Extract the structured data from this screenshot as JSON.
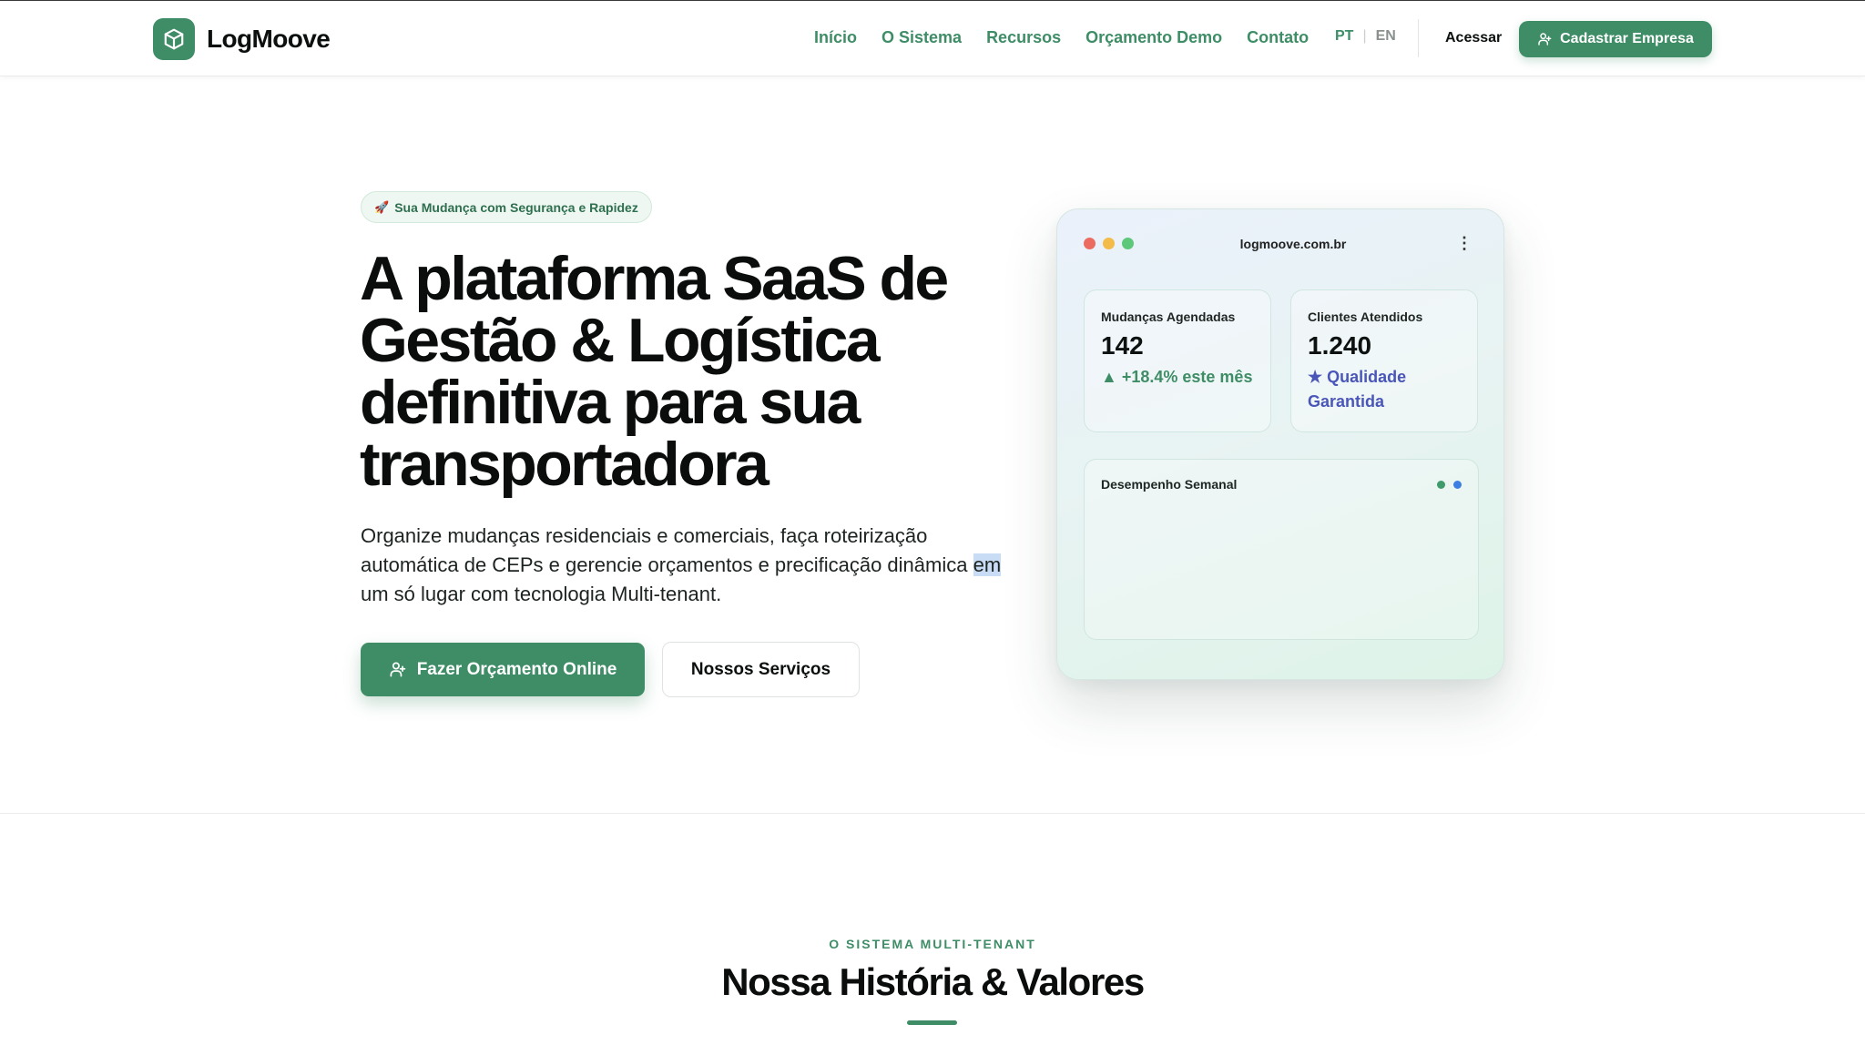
{
  "brand": {
    "name": "LogMoove",
    "icon": "cube-icon"
  },
  "nav": {
    "links": [
      "Início",
      "O Sistema",
      "Recursos",
      "Orçamento Demo",
      "Contato"
    ],
    "lang_pt": "PT",
    "lang_sep": "|",
    "lang_en": "EN",
    "login": "Acessar",
    "signup": "Cadastrar Empresa",
    "signup_icon": "user-plus-icon"
  },
  "hero": {
    "badge_icon": "🚀",
    "badge": "Sua Mudança com Segurança e Rapidez",
    "title": "A plataforma SaaS de Gestão & Logística definitiva para sua transportadora",
    "description_before": "Organize mudanças residenciais e comerciais, faça roteirização automática de CEPs e gerencie orçamentos e precificação dinâmica ",
    "description_selected": "em",
    "description_after": " um só lugar com tecnologia Multi-tenant.",
    "primary_button": "Fazer Orçamento Online",
    "primary_icon": "user-plus-icon",
    "secondary_button": "Nossos Serviços"
  },
  "mockup": {
    "url": "logmoove.com.br",
    "menu_icon": "more-vertical-icon",
    "card1": {
      "label": "Mudanças Agendadas",
      "value": "142",
      "sub_icon": "▲",
      "sub": "+18.4% este mês"
    },
    "card2": {
      "label": "Clientes Atendidos",
      "value": "1.240",
      "sub_icon": "★",
      "sub": "Qualidade Garantida"
    },
    "chart_label": "Desempenho Semanal"
  },
  "section": {
    "eyebrow": "O SISTEMA MULTI-TENANT",
    "title": "Nossa História & Valores"
  },
  "colors": {
    "brand_green": "#3f8d66",
    "accent_blue": "#4a56b8",
    "dot_red": "#ec6b60",
    "dot_yellow": "#f3bc4a",
    "dot_green": "#5ec87a",
    "legend_green": "#3f9a6c",
    "legend_blue": "#3d7ee3"
  }
}
